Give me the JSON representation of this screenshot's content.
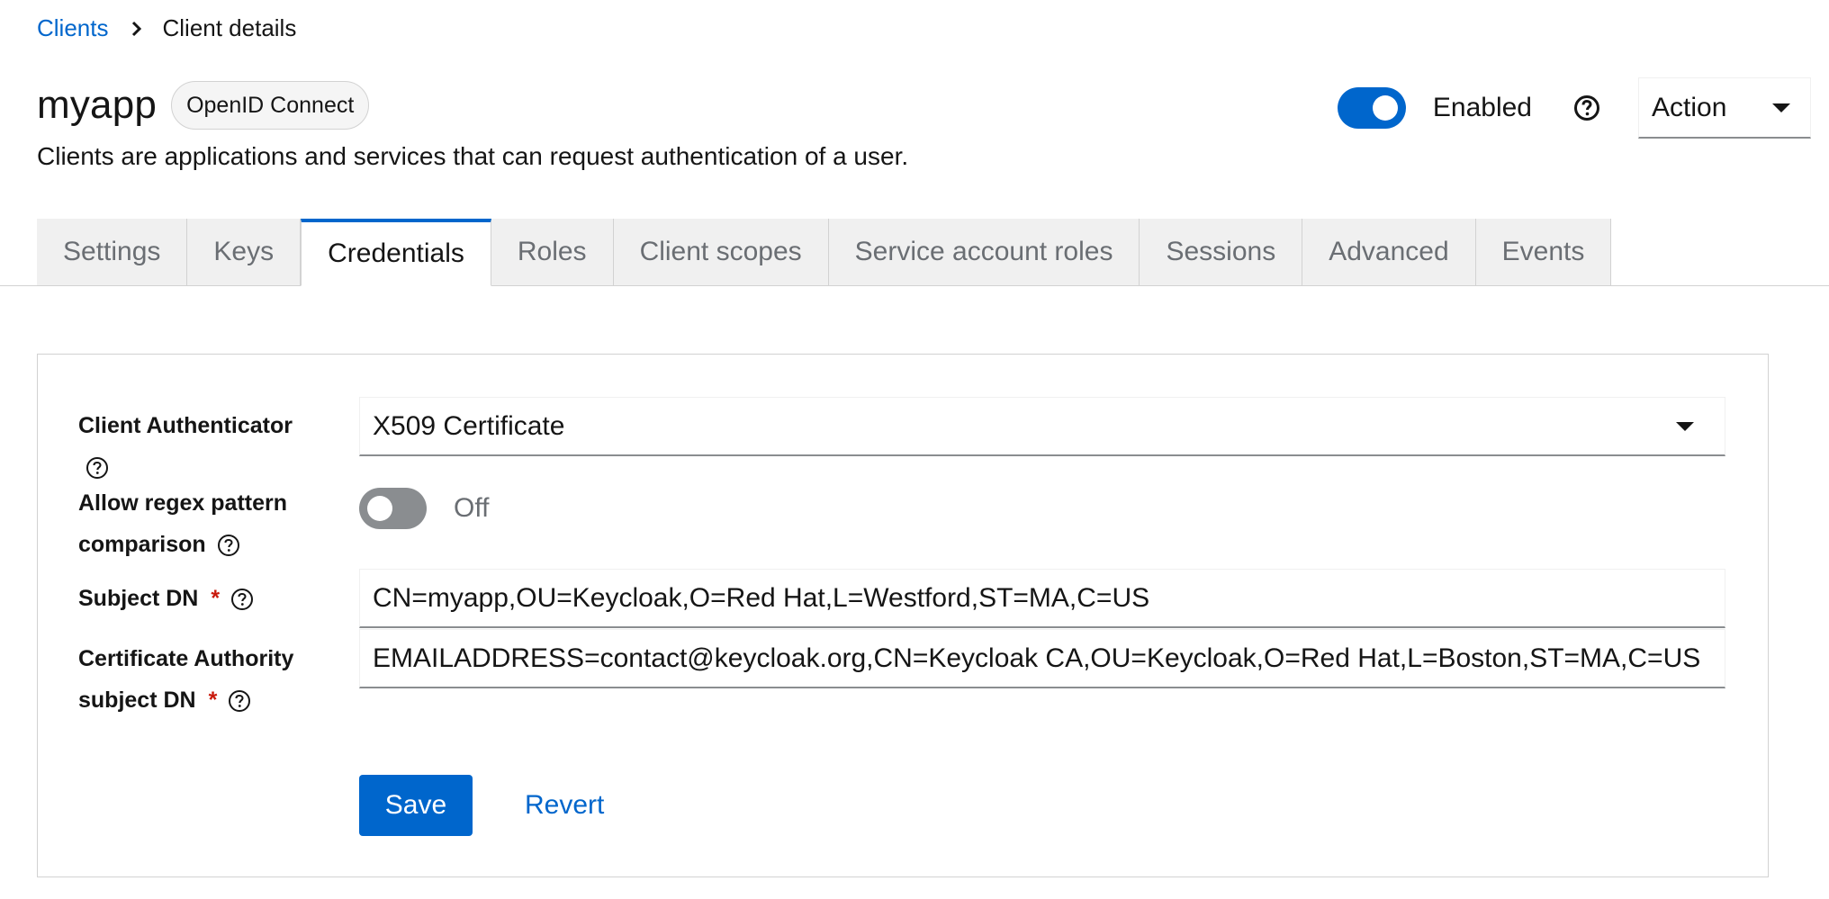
{
  "breadcrumb": {
    "parent": "Clients",
    "current": "Client details"
  },
  "header": {
    "title": "myapp",
    "protocol_badge": "OpenID Connect",
    "description": "Clients are applications and services that can request authentication of a user.",
    "enabled_label": "Enabled",
    "enabled": true,
    "action_label": "Action"
  },
  "tabs": [
    {
      "label": "Settings",
      "active": false
    },
    {
      "label": "Keys",
      "active": false
    },
    {
      "label": "Credentials",
      "active": true
    },
    {
      "label": "Roles",
      "active": false
    },
    {
      "label": "Client scopes",
      "active": false
    },
    {
      "label": "Service account roles",
      "active": false
    },
    {
      "label": "Sessions",
      "active": false
    },
    {
      "label": "Advanced",
      "active": false
    },
    {
      "label": "Events",
      "active": false
    }
  ],
  "form": {
    "client_authenticator": {
      "label": "Client Authenticator",
      "value": "X509 Certificate"
    },
    "allow_regex": {
      "label_line1": "Allow regex pattern",
      "label_line2": "comparison",
      "state_label": "Off",
      "enabled": false
    },
    "subject_dn": {
      "label": "Subject DN",
      "required_mark": "*",
      "value": "CN=myapp,OU=Keycloak,O=Red Hat,L=Westford,ST=MA,C=US"
    },
    "ca_subject_dn": {
      "label_line1": "Certificate Authority",
      "label_line2": "subject DN",
      "required_mark": "*",
      "value": "EMAILADDRESS=contact@keycloak.org,CN=Keycloak CA,OU=Keycloak,O=Red Hat,L=Boston,ST=MA,C=US"
    },
    "save_label": "Save",
    "revert_label": "Revert"
  },
  "colors": {
    "accent": "#0066cc",
    "required": "#c9190b",
    "tab_inactive_bg": "#f0f0f0"
  },
  "icons": {
    "breadcrumb_separator": "chevron-right-icon",
    "header_help": "question-circle-icon",
    "field_help": "help-outline-icon",
    "dropdown": "caret-down-icon"
  }
}
